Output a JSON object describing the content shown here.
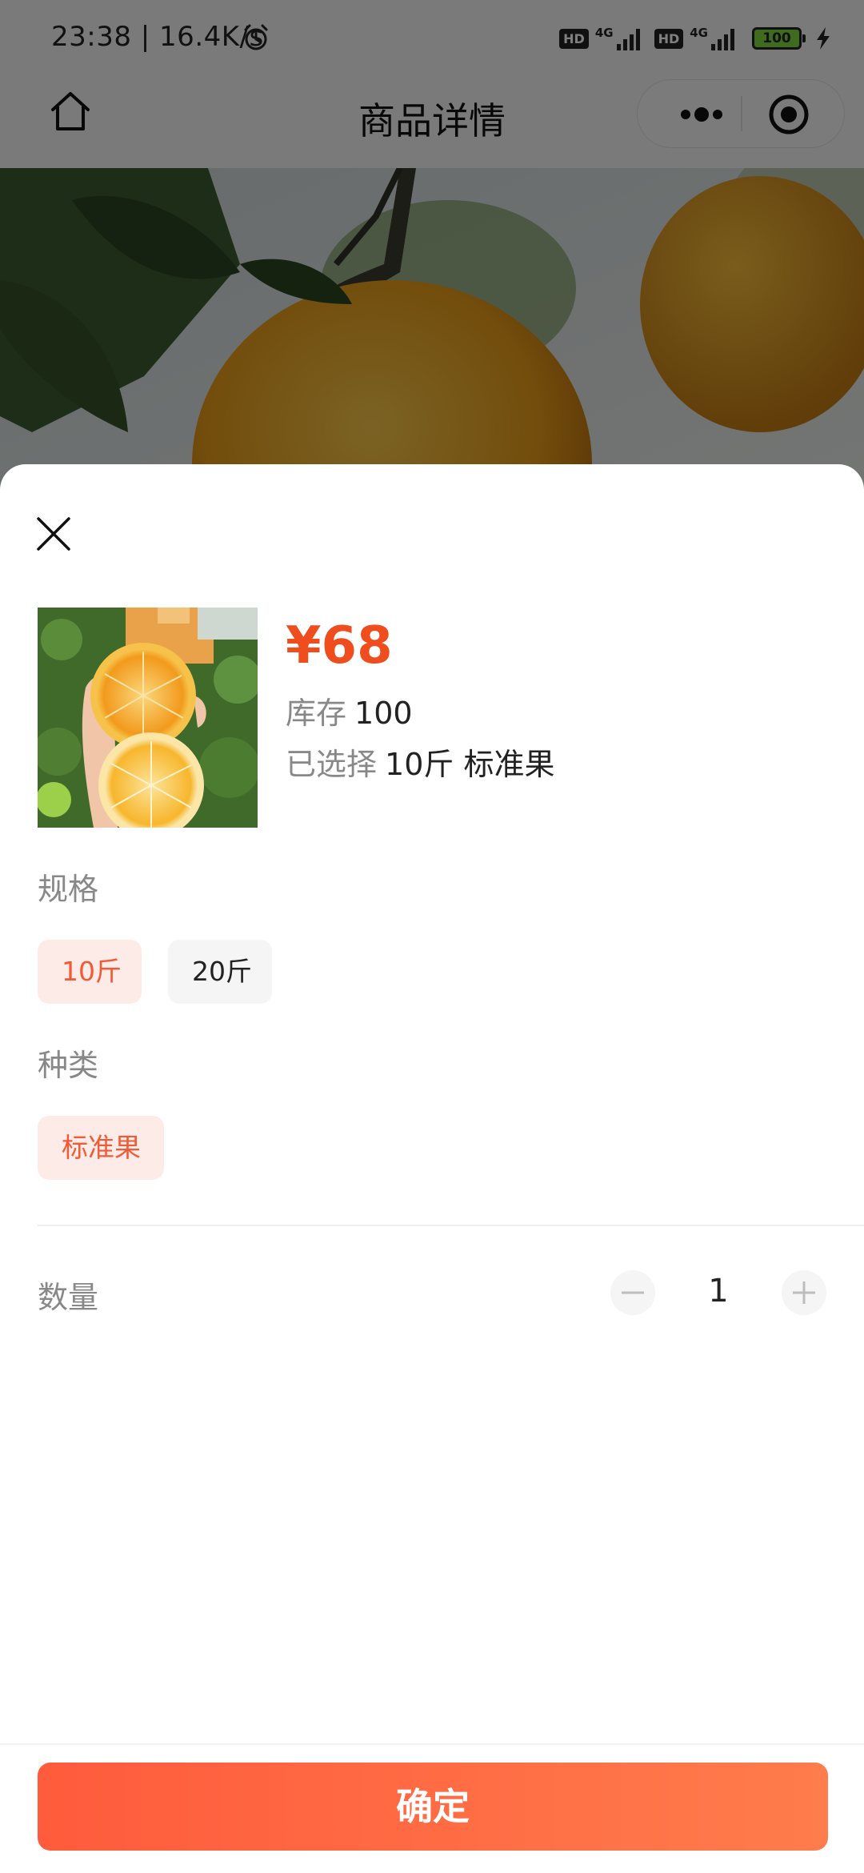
{
  "status_bar": {
    "time": "23:38 | 16.4K/s",
    "hd_1": "HD",
    "net_1": "4G",
    "hd_2": "HD",
    "net_2": "4G",
    "battery": "100"
  },
  "nav": {
    "title": "商品详情"
  },
  "sheet": {
    "price": "¥68",
    "stock_label": "库存",
    "stock_value": "100",
    "selected_label": "已选择",
    "selected_value": "10斤 标准果",
    "spec": {
      "title": "规格",
      "options": [
        "10斤",
        "20斤"
      ],
      "selected": "10斤"
    },
    "variety": {
      "title": "种类",
      "options": [
        "标准果"
      ],
      "selected": "标准果"
    },
    "quantity": {
      "label": "数量",
      "value": "1"
    },
    "confirm_label": "确定"
  },
  "colors": {
    "accent": "#f04d1f",
    "chip_active_bg": "#fdebe7",
    "chip_active_text": "#f15a36",
    "button_gradient_start": "#ff5b3c",
    "button_gradient_end": "#ff7c4c"
  },
  "icons": {
    "home": "home-icon",
    "more": "more-dots-icon",
    "target": "target-icon",
    "close": "close-icon",
    "minus": "minus-icon",
    "plus": "plus-icon",
    "alarm": "alarm-clock-icon",
    "charging": "bolt-icon"
  }
}
